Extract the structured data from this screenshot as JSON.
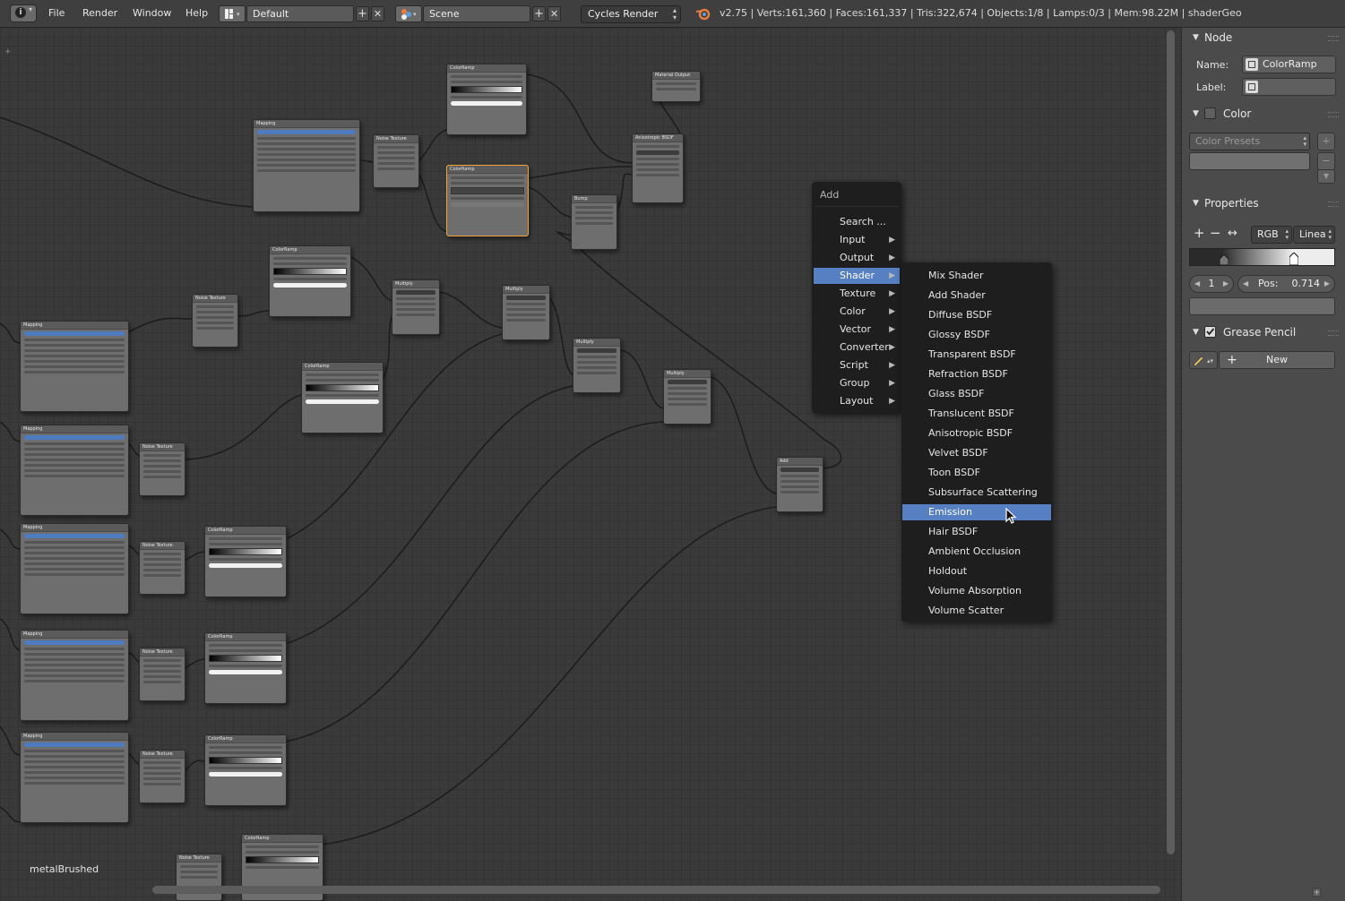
{
  "topbar": {
    "menus": [
      "File",
      "Render",
      "Window",
      "Help"
    ],
    "layout_name": "Default",
    "scene_name": "Scene",
    "render_engine": "Cycles Render",
    "stats": "v2.75 | Verts:161,360 | Faces:161,337 | Tris:322,674 | Objects:1/8 | Lamps:0/3 | Mem:98.22M | shaderGeo"
  },
  "editor": {
    "material_name": "metalBrushed",
    "node_labels": {
      "color_ramp": "ColorRamp",
      "mapping": "Mapping",
      "noise_texture": "Noise Texture",
      "multiply": "Multiply",
      "add": "Add",
      "anisotropic": "Anisotropic BSDF",
      "bump": "Bump",
      "material_output": "Material Output"
    }
  },
  "add_menu": {
    "title": "Add",
    "items": [
      {
        "label": "Search ...",
        "submenu": false,
        "highlighted": false
      },
      {
        "label": "Input",
        "submenu": true,
        "highlighted": false
      },
      {
        "label": "Output",
        "submenu": true,
        "highlighted": false
      },
      {
        "label": "Shader",
        "submenu": true,
        "highlighted": true
      },
      {
        "label": "Texture",
        "submenu": true,
        "highlighted": false
      },
      {
        "label": "Color",
        "submenu": true,
        "highlighted": false
      },
      {
        "label": "Vector",
        "submenu": true,
        "highlighted": false
      },
      {
        "label": "Converter",
        "submenu": true,
        "highlighted": false
      },
      {
        "label": "Script",
        "submenu": true,
        "highlighted": false
      },
      {
        "label": "Group",
        "submenu": true,
        "highlighted": false
      },
      {
        "label": "Layout",
        "submenu": true,
        "highlighted": false
      }
    ]
  },
  "shader_menu": {
    "items": [
      {
        "label": "Mix Shader",
        "highlighted": false
      },
      {
        "label": "Add Shader",
        "highlighted": false
      },
      {
        "label": "Diffuse BSDF",
        "highlighted": false
      },
      {
        "label": "Glossy BSDF",
        "highlighted": false
      },
      {
        "label": "Transparent BSDF",
        "highlighted": false
      },
      {
        "label": "Refraction BSDF",
        "highlighted": false
      },
      {
        "label": "Glass BSDF",
        "highlighted": false
      },
      {
        "label": "Translucent BSDF",
        "highlighted": false
      },
      {
        "label": "Anisotropic BSDF",
        "highlighted": false
      },
      {
        "label": "Velvet BSDF",
        "highlighted": false
      },
      {
        "label": "Toon BSDF",
        "highlighted": false
      },
      {
        "label": "Subsurface Scattering",
        "highlighted": false
      },
      {
        "label": "Emission",
        "highlighted": true
      },
      {
        "label": "Hair BSDF",
        "highlighted": false
      },
      {
        "label": "Ambient Occlusion",
        "highlighted": false
      },
      {
        "label": "Holdout",
        "highlighted": false
      },
      {
        "label": "Volume Absorption",
        "highlighted": false
      },
      {
        "label": "Volume Scatter",
        "highlighted": false
      }
    ]
  },
  "panel": {
    "node_section": "Node",
    "name_label": "Name:",
    "name_value": "ColorRamp",
    "label_label": "Label:",
    "label_value": "",
    "color_section": "Color",
    "color_presets": "Color Presets",
    "properties_section": "Properties",
    "color_mode": "RGB",
    "interpolation": "Linea",
    "stop_index": "1",
    "pos_label": "Pos:",
    "pos_value": "0.714",
    "grease_pencil_section": "Grease Pencil",
    "new_button": "New"
  },
  "colors": {
    "highlight": "#5680c2",
    "selected_node_border": "#f2a33a"
  }
}
